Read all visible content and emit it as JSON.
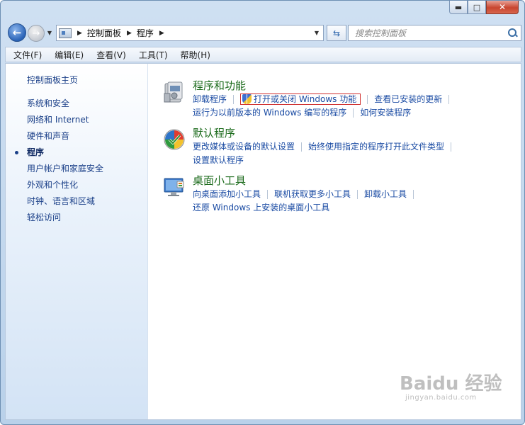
{
  "window": {
    "minimize_glyph": "▬",
    "maximize_glyph": "□",
    "close_glyph": "✕"
  },
  "address_bar": {
    "breadcrumbs": [
      "控制面板",
      "程序"
    ]
  },
  "search": {
    "placeholder": "搜索控制面板"
  },
  "menu": {
    "items": [
      "文件(F)",
      "编辑(E)",
      "查看(V)",
      "工具(T)",
      "帮助(H)"
    ]
  },
  "sidebar": {
    "home": "控制面板主页",
    "items": [
      {
        "label": "系统和安全",
        "active": false
      },
      {
        "label": "网络和 Internet",
        "active": false
      },
      {
        "label": "硬件和声音",
        "active": false
      },
      {
        "label": "程序",
        "active": true
      },
      {
        "label": "用户帐户和家庭安全",
        "active": false
      },
      {
        "label": "外观和个性化",
        "active": false
      },
      {
        "label": "时钟、语言和区域",
        "active": false
      },
      {
        "label": "轻松访问",
        "active": false
      }
    ]
  },
  "categories": [
    {
      "title": "程序和功能",
      "icon": "programs-features-icon",
      "links": [
        "卸载程序",
        "打开或关闭 Windows 功能",
        "查看已安装的更新",
        "运行为以前版本的 Windows 编写的程序",
        "如何安装程序"
      ]
    },
    {
      "title": "默认程序",
      "icon": "default-programs-icon",
      "links": [
        "更改媒体或设备的默认设置",
        "始终使用指定的程序打开此文件类型",
        "设置默认程序"
      ]
    },
    {
      "title": "桌面小工具",
      "icon": "desktop-gadgets-icon",
      "links": [
        "向桌面添加小工具",
        "联机获取更多小工具",
        "卸载小工具",
        "还原 Windows 上安装的桌面小工具"
      ]
    }
  ],
  "highlighted_link": "打开或关闭 Windows 功能",
  "colors": {
    "category_title": "#1c6b1c",
    "link": "#1a4ba3",
    "highlight_border": "#d03030"
  },
  "watermark": {
    "logo": "Baidu 经验",
    "url": "jingyan.baidu.com"
  }
}
